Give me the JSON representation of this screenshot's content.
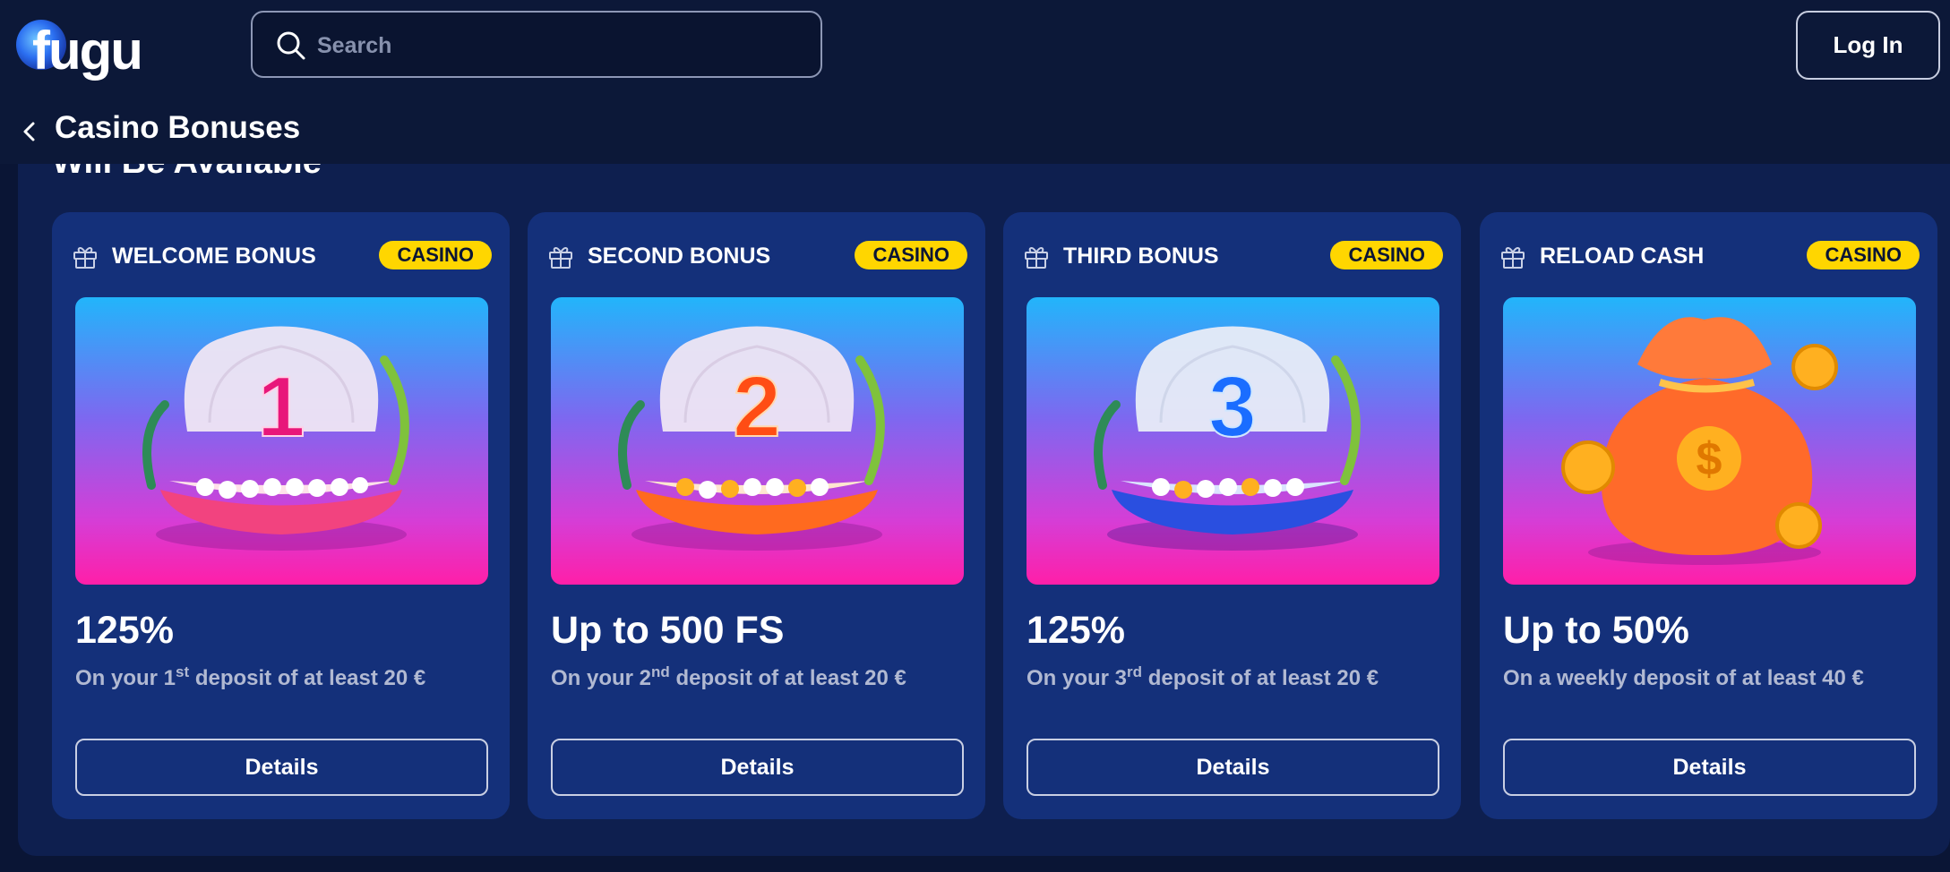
{
  "header": {
    "logo_text": "fugu",
    "search_placeholder": "Search",
    "login_label": "Log In"
  },
  "page": {
    "title": "Casino Bonuses",
    "section_heading": "Will Be Available"
  },
  "cards": [
    {
      "title": "WELCOME BONUS",
      "badge": "CASINO",
      "image_label": "1",
      "amount": "125%",
      "desc_pre": "On your 1",
      "desc_sup": "st",
      "desc_post": " deposit of at least 20 €",
      "details_label": "Details"
    },
    {
      "title": "SECOND BONUS",
      "badge": "CASINO",
      "image_label": "2",
      "amount": "Up to 500 FS",
      "desc_pre": "On your 2",
      "desc_sup": "nd",
      "desc_post": " deposit of at least 20 €",
      "details_label": "Details"
    },
    {
      "title": "THIRD BONUS",
      "badge": "CASINO",
      "image_label": "3",
      "amount": "125%",
      "desc_pre": "On your 3",
      "desc_sup": "rd",
      "desc_post": " deposit of at least 20 €",
      "details_label": "Details"
    },
    {
      "title": "RELOAD CASH",
      "badge": "CASINO",
      "amount": "Up to 50%",
      "desc_pre": "On a weekly deposit of at least 40 €",
      "desc_sup": "",
      "desc_post": "",
      "details_label": "Details"
    }
  ],
  "colors": {
    "background": "#0a1535",
    "card": "#14307a",
    "badge": "#ffd600",
    "badge_text": "#0a1535",
    "desc_text": "#b1b9d2"
  }
}
